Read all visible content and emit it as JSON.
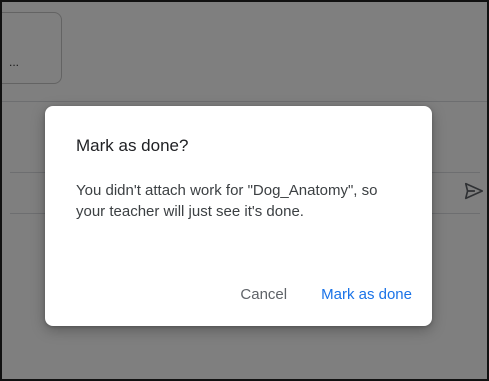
{
  "background": {
    "attachment_card": {
      "ellipsis": "..."
    },
    "send_icon": "send-icon"
  },
  "dialog": {
    "title": "Mark as done?",
    "message": "You didn't attach work for \"Dog_Anatomy\", so your teacher will just see it's done.",
    "cancel_label": "Cancel",
    "confirm_label": "Mark as done"
  },
  "colors": {
    "primary_accent": "#1a73e8",
    "cancel_text": "#5f6368",
    "title_text": "#202124",
    "body_text": "#3c4043",
    "scrim": "rgba(0,0,0,0.5)"
  }
}
